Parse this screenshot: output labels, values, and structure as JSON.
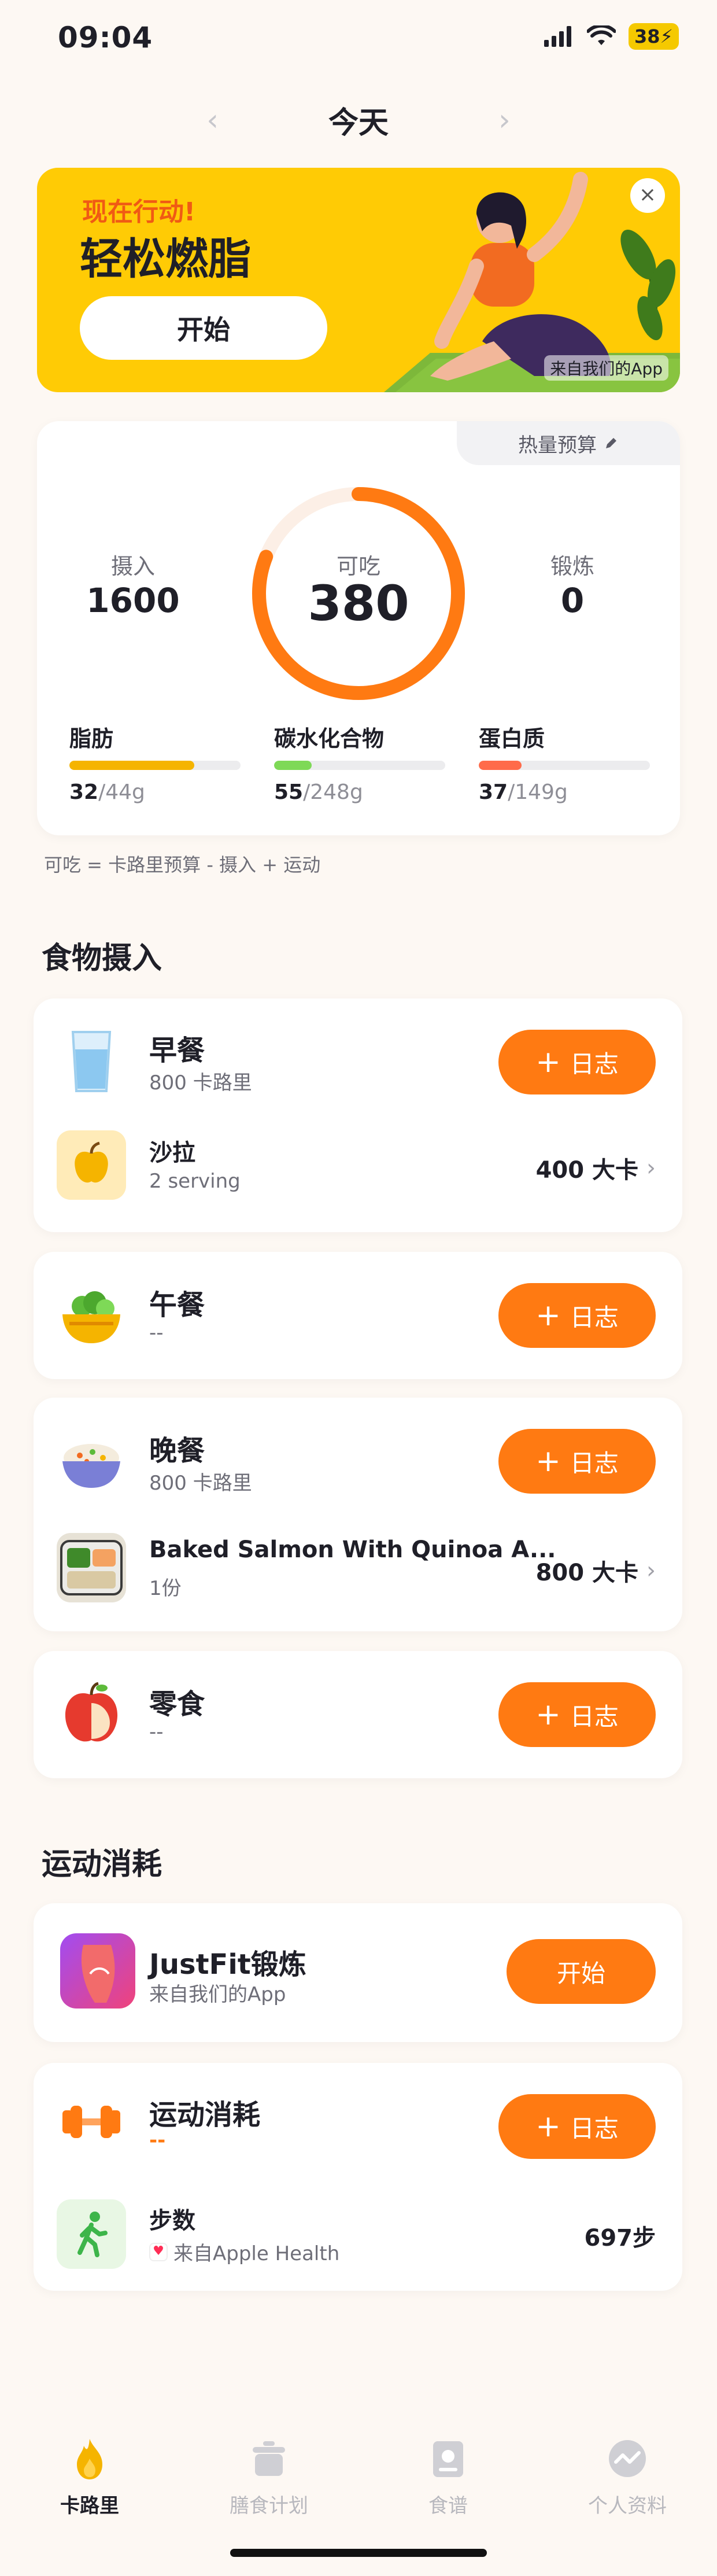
{
  "status_bar": {
    "time": "09:04",
    "battery": "38"
  },
  "date_nav": {
    "title": "今天"
  },
  "banner": {
    "subtitle": "现在行动!",
    "title": "轻松燃脂",
    "button_label": "开始",
    "source": "来自我们的App"
  },
  "calories": {
    "budget_tab": "热量预算",
    "intake_label": "摄入",
    "intake_value": "1600",
    "remaining_label": "可吃",
    "remaining_value": "380",
    "remaining_fraction": 0.81,
    "exercise_label": "锻炼",
    "exercise_value": "0",
    "macros": [
      {
        "name": "脂肪",
        "current": "32",
        "target": "/44g",
        "fraction": 0.73,
        "color": "#F5B400"
      },
      {
        "name": "碳水化合物",
        "current": "55",
        "target": "/248g",
        "fraction": 0.22,
        "color": "#7ED957"
      },
      {
        "name": "蛋白质",
        "current": "37",
        "target": "/149g",
        "fraction": 0.25,
        "color": "#FF6B4A"
      }
    ],
    "formula": "可吃 = 卡路里预算 - 摄入 + 运动"
  },
  "food_section": {
    "title": "食物摄入"
  },
  "meals": {
    "breakfast": {
      "name": "早餐",
      "sub": "800 卡路里",
      "log_label": "日志"
    },
    "breakfast_item": {
      "name": "沙拉",
      "sub": "2 serving",
      "kcal": "400 大卡"
    },
    "lunch": {
      "name": "午餐",
      "sub": "--",
      "log_label": "日志"
    },
    "dinner": {
      "name": "晚餐",
      "sub": "800 卡路里",
      "log_label": "日志"
    },
    "dinner_item": {
      "name": "Baked Salmon With Quinoa A...",
      "sub": "1份",
      "kcal": "800 大卡"
    },
    "snack": {
      "name": "零食",
      "sub": "--",
      "log_label": "日志"
    }
  },
  "exercise_section": {
    "title": "运动消耗"
  },
  "justfit": {
    "name": "JustFit锻炼",
    "sub": "来自我们的App",
    "button_label": "开始"
  },
  "exercise": {
    "name": "运动消耗",
    "sub": "--",
    "log_label": "日志"
  },
  "steps": {
    "name": "步数",
    "source": "来自Apple Health",
    "value": "697步"
  },
  "tabs": [
    {
      "label": "卡路里",
      "icon": "flame-icon",
      "active": true
    },
    {
      "label": "膳食计划",
      "icon": "pot-icon",
      "active": false
    },
    {
      "label": "食谱",
      "icon": "recipe-book-icon",
      "active": false
    },
    {
      "label": "个人资料",
      "icon": "profile-chart-icon",
      "active": false
    }
  ],
  "colors": {
    "accent": "#FF7A12",
    "banner": "#FFCB05",
    "background": "#FDF8F3"
  }
}
